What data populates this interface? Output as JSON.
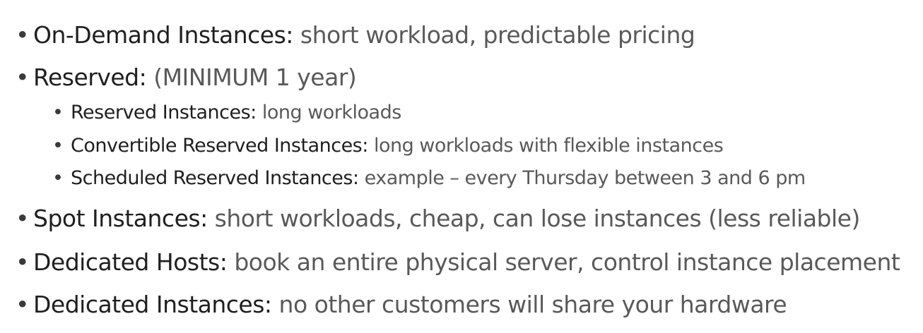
{
  "bullets": [
    {
      "term": "On-Demand Instances:",
      "desc": " short workload, predictable pricing"
    },
    {
      "term": "Reserved:",
      "desc": " (MINIMUM 1 year)"
    },
    {
      "term": "Reserved Instances:",
      "desc": " long workloads"
    },
    {
      "term": "Convertible Reserved Instances:",
      "desc": " long workloads with flexible instances"
    },
    {
      "term": "Scheduled Reserved Instances:",
      "desc": " example – every Thursday between 3 and 6 pm"
    },
    {
      "term": "Spot Instances:",
      "desc": " short workloads, cheap, can lose instances (less reliable)"
    },
    {
      "term": "Dedicated Hosts:",
      "desc": " book an entire physical server, control instance placement"
    },
    {
      "term": "Dedicated Instances:",
      "desc": " no other customers will share your hardware"
    }
  ],
  "bullet_symbol": "•"
}
